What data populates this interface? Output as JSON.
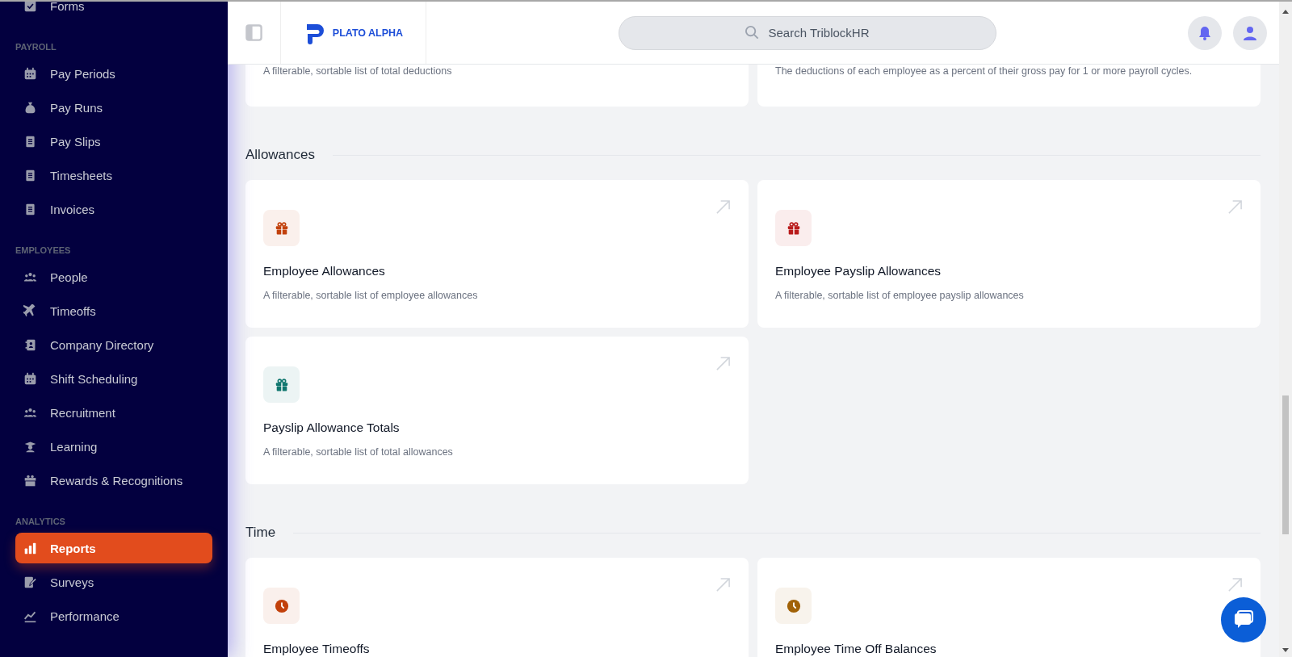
{
  "sidebar": {
    "sections": [
      {
        "items": [
          {
            "label": "Forms",
            "kind": "check",
            "selected": false
          }
        ]
      },
      {
        "heading": "PAYROLL",
        "items": [
          {
            "label": "Pay Periods",
            "kind": "calendar",
            "selected": false
          },
          {
            "label": "Pay Runs",
            "kind": "moneybag",
            "selected": false
          },
          {
            "label": "Pay Slips",
            "kind": "receipt",
            "selected": false
          },
          {
            "label": "Timesheets",
            "kind": "clipboard",
            "selected": false
          },
          {
            "label": "Invoices",
            "kind": "invoice",
            "selected": false
          }
        ]
      },
      {
        "heading": "EMPLOYEES",
        "items": [
          {
            "label": "People",
            "kind": "people",
            "selected": false
          },
          {
            "label": "Timeoffs",
            "kind": "plane",
            "selected": false
          },
          {
            "label": "Company Directory",
            "kind": "contact",
            "selected": false
          },
          {
            "label": "Shift Scheduling",
            "kind": "calendar",
            "selected": false
          },
          {
            "label": "Recruitment",
            "kind": "people",
            "selected": false
          },
          {
            "label": "Learning",
            "kind": "graduate",
            "selected": false
          },
          {
            "label": "Rewards & Recognitions",
            "kind": "gift",
            "selected": false
          }
        ]
      },
      {
        "heading": "ANALYTICS",
        "items": [
          {
            "label": "Reports",
            "kind": "chart",
            "selected": true
          },
          {
            "label": "Surveys",
            "kind": "survey",
            "selected": false
          },
          {
            "label": "Performance",
            "kind": "trend",
            "selected": false
          }
        ]
      }
    ]
  },
  "header": {
    "logo": "PLATO ALPHA",
    "search": {
      "placeholder": "Search TriblockHR"
    }
  },
  "top_cards": [
    {
      "description": "A filterable, sortable list of total deductions"
    },
    {
      "description": "The deductions of each employee as a percent of their gross pay for 1 or more payroll cycles."
    }
  ],
  "sections": [
    {
      "title": "Allowances",
      "cards": [
        {
          "title": "Employee Allowances",
          "description": "A filterable, sortable list of employee allowances",
          "kind": "gift",
          "color": "#c2410c"
        },
        {
          "title": "Employee Payslip Allowances",
          "description": "A filterable, sortable list of employee payslip allowances",
          "kind": "gift",
          "color": "#b91c1c"
        },
        {
          "title": "Payslip Allowance Totals",
          "description": "A filterable, sortable list of total allowances",
          "kind": "gift",
          "color": "#0f766e"
        }
      ]
    },
    {
      "title": "Time",
      "cards": [
        {
          "title": "Employee Timeoffs",
          "kind": "clock",
          "color": "#c2410c"
        },
        {
          "title": "Employee Time Off Balances",
          "kind": "clock",
          "color": "#a16207"
        }
      ]
    }
  ]
}
